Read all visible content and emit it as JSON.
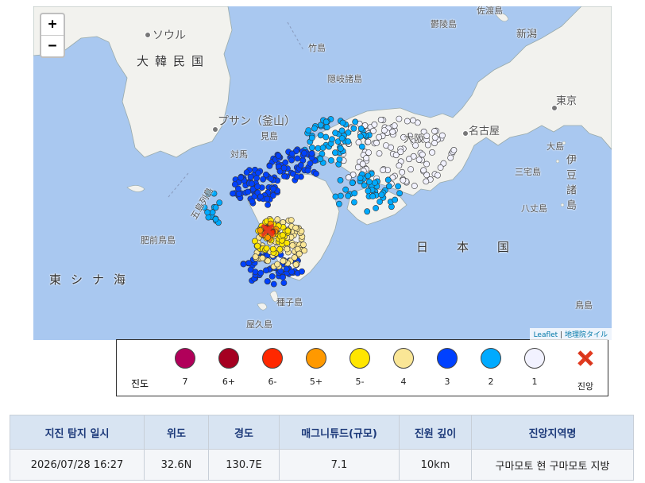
{
  "map": {
    "zoom_in": "+",
    "zoom_out": "−",
    "attribution": {
      "leaflet": "Leaflet",
      "separator": " | ",
      "tiles": "地理院タイル"
    },
    "labels": {
      "seoul": "ソウル",
      "korea": "大韓民国",
      "busan": "プサン（釜山）",
      "tsushima": "対馬",
      "goto": "五島列島",
      "hizen": "肥前鳥島",
      "ecs": "東シナ海",
      "takeshima": "竹島",
      "oki": "隠岐諸島",
      "mishima": "見島",
      "ulleungdo": "鬱陵島",
      "sado": "佐渡島",
      "niigata": "新潟",
      "tokyo": "東京",
      "nagoya": "名古屋",
      "oshima": "大島",
      "miyake": "三宅島",
      "hachijo": "八丈島",
      "izu": "伊豆諸島",
      "japan": "日本国",
      "tanegashima": "種子島",
      "yakushima": "屋久島",
      "torishima": "鳥島",
      "osaka": "大阪"
    },
    "colors": {
      "sea": "#a9c8f0",
      "land": "#f2f2ee",
      "int7": "#b1005a",
      "int6p": "#a50021",
      "int6m": "#ff2800",
      "int5p": "#ff9900",
      "int5m": "#ffe600",
      "int4": "#fae696",
      "int3": "#0041ff",
      "int2": "#00aaff",
      "int1": "#f2f2ff",
      "epicenter": "#e23b20"
    }
  },
  "legend": {
    "title": "진도",
    "items": [
      {
        "label": "7",
        "color": "#b1005a"
      },
      {
        "label": "6+",
        "color": "#a50021"
      },
      {
        "label": "6-",
        "color": "#ff2800"
      },
      {
        "label": "5+",
        "color": "#ff9900"
      },
      {
        "label": "5-",
        "color": "#ffe600"
      },
      {
        "label": "4",
        "color": "#fae696"
      },
      {
        "label": "3",
        "color": "#0041ff"
      },
      {
        "label": "2",
        "color": "#00aaff"
      },
      {
        "label": "1",
        "color": "#f2f2ff"
      }
    ],
    "epicenter_label": "진앙",
    "epicenter_icon": "x-mark-icon"
  },
  "table": {
    "headers": [
      "지진 탐지 일시",
      "위도",
      "경도",
      "매그니튜드(규모)",
      "진원 깊이",
      "진앙지역명"
    ],
    "rows": [
      [
        "2026/07/28 16:27",
        "32.6N",
        "130.7E",
        "7.1",
        "10km",
        "구마모토 현 구마모토 지방"
      ]
    ]
  }
}
